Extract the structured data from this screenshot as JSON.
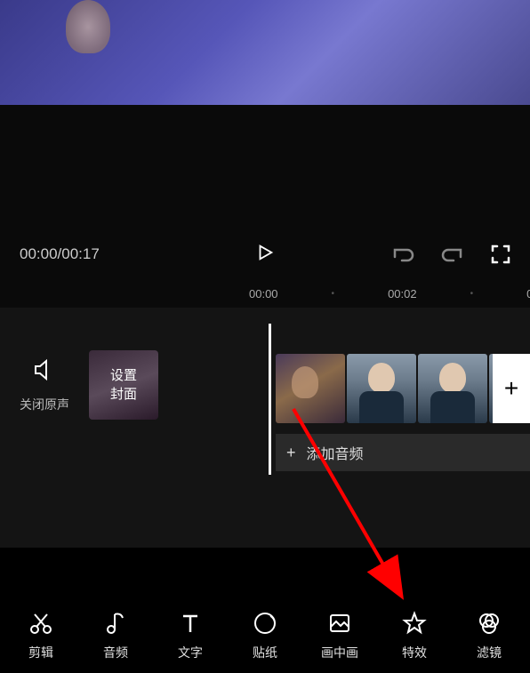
{
  "playback": {
    "currentTime": "00:00",
    "duration": "00:17",
    "displayString": "00:00/00:17"
  },
  "timeline": {
    "ruler": [
      "00:00",
      "00:02",
      "0"
    ],
    "mute": {
      "label": "关闭原声"
    },
    "cover": {
      "line1": "设置",
      "line2": "封面"
    },
    "addClip": "+",
    "addAudio": {
      "plus": "+",
      "label": "添加音频"
    }
  },
  "toolbar": [
    {
      "id": "edit",
      "label": "剪辑"
    },
    {
      "id": "audio",
      "label": "音频"
    },
    {
      "id": "text",
      "label": "文字"
    },
    {
      "id": "sticker",
      "label": "贴纸"
    },
    {
      "id": "pip",
      "label": "画中画"
    },
    {
      "id": "effects",
      "label": "特效"
    },
    {
      "id": "filter",
      "label": "滤镜"
    }
  ]
}
